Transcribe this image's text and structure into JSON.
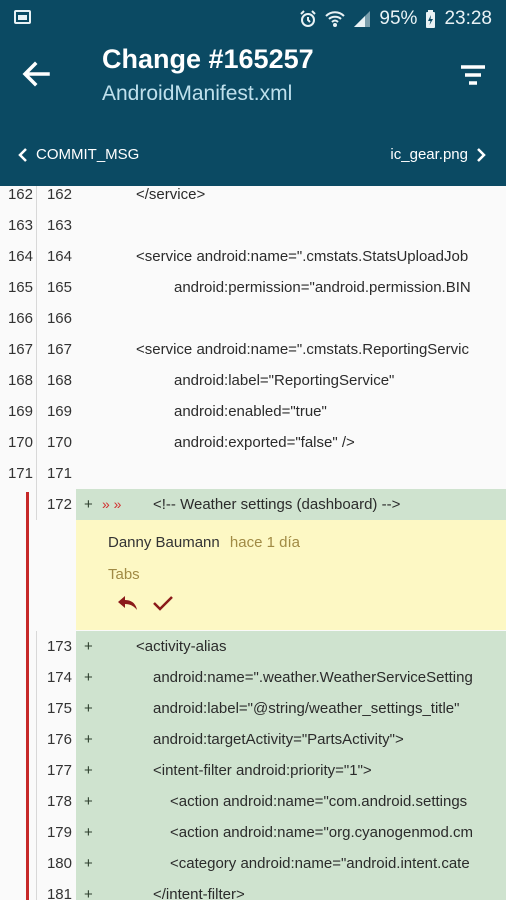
{
  "status_bar": {
    "battery": "95%",
    "time": "23:28"
  },
  "header": {
    "title": "Change #165257",
    "subtitle": "AndroidManifest.xml"
  },
  "nav": {
    "prev_label": "COMMIT_MSG",
    "next_label": "ic_gear.png"
  },
  "lines": [
    {
      "a": "162",
      "b": "162",
      "code": "</service>",
      "indent": 1,
      "added": false
    },
    {
      "a": "163",
      "b": "163",
      "code": "",
      "indent": 0,
      "added": false
    },
    {
      "a": "164",
      "b": "164",
      "code": "<service android:name=\".cmstats.StatsUploadJob",
      "indent": 1,
      "added": false
    },
    {
      "a": "165",
      "b": "165",
      "code": "android:permission=\"android.permission.BIN",
      "indent": 2,
      "added": false
    },
    {
      "a": "166",
      "b": "166",
      "code": "",
      "indent": 0,
      "added": false
    },
    {
      "a": "167",
      "b": "167",
      "code": "<service android:name=\".cmstats.ReportingServic",
      "indent": 1,
      "added": false
    },
    {
      "a": "168",
      "b": "168",
      "code": "android:label=\"ReportingService\"",
      "indent": 2,
      "added": false
    },
    {
      "a": "169",
      "b": "169",
      "code": "android:enabled=\"true\"",
      "indent": 2,
      "added": false
    },
    {
      "a": "170",
      "b": "170",
      "code": "android:exported=\"false\" />",
      "indent": 2,
      "added": false
    },
    {
      "a": "171",
      "b": "171",
      "code": "",
      "indent": 0,
      "added": false
    }
  ],
  "added_lines": [
    {
      "b": "172",
      "code": "<!-- Weather settings (dashboard) -->",
      "indent": 0,
      "tab_markers": "»   »"
    },
    {
      "b": "173",
      "code": "<activity-alias",
      "indent": 1
    },
    {
      "b": "174",
      "code": "android:name=\".weather.WeatherServiceSetting",
      "indent": 2
    },
    {
      "b": "175",
      "code": "android:label=\"@string/weather_settings_title\"",
      "indent": 2
    },
    {
      "b": "176",
      "code": "android:targetActivity=\"PartsActivity\">",
      "indent": 2
    },
    {
      "b": "177",
      "code": "<intent-filter android:priority=\"1\">",
      "indent": 2
    },
    {
      "b": "178",
      "code": "<action android:name=\"com.android.settings",
      "indent": 3
    },
    {
      "b": "179",
      "code": "<action android:name=\"org.cyanogenmod.cm",
      "indent": 3
    },
    {
      "b": "180",
      "code": "<category android:name=\"android.intent.cate",
      "indent": 3
    },
    {
      "b": "181",
      "code": "</intent-filter>",
      "indent": 2
    }
  ],
  "comment": {
    "author": "Danny Baumann",
    "when": "hace 1 día",
    "message": "Tabs"
  },
  "plus_sign": "+",
  "colors": {
    "toolbar": "#0b4a63",
    "added_bg": "#cfe3cf",
    "comment_bg": "#fdf8c4",
    "marker": "#c62828"
  }
}
